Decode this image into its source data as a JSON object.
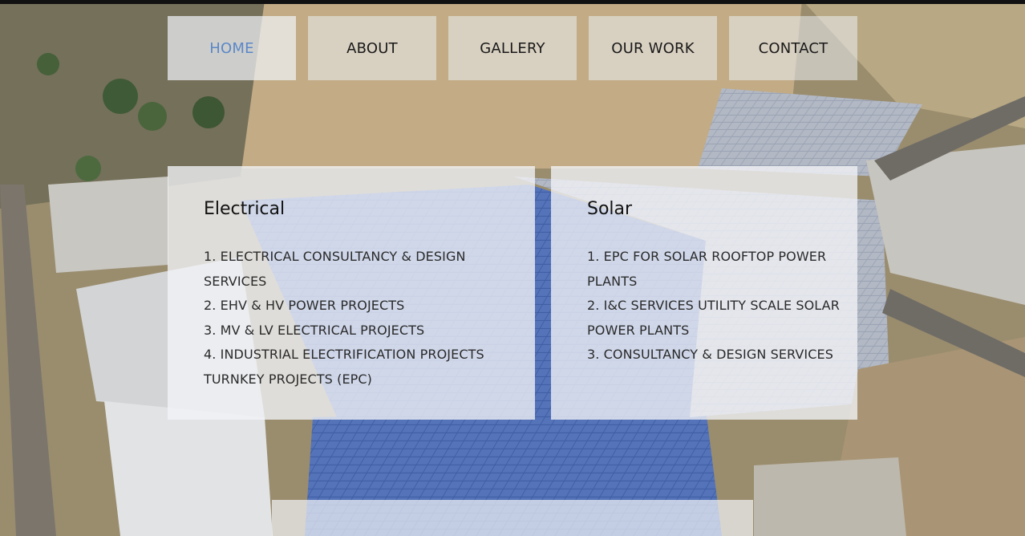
{
  "nav": {
    "items": [
      {
        "label": "HOME",
        "active": true
      },
      {
        "label": "ABOUT",
        "active": false
      },
      {
        "label": "GALLERY",
        "active": false
      },
      {
        "label": "OUR WORK",
        "active": false
      },
      {
        "label": "CONTACT",
        "active": false
      }
    ],
    "active_color": "#5b87c9"
  },
  "services": {
    "electrical": {
      "title": "Electrical",
      "items": [
        "1. ELECTRICAL CONSULTANCY & DESIGN SERVICES",
        "2. EHV & HV POWER PROJECTS",
        "3. MV & LV ELECTRICAL PROJECTS",
        "4. INDUSTRIAL ELECTRIFICATION PROJECTS TURNKEY PROJECTS (EPC)"
      ]
    },
    "solar": {
      "title": "Solar",
      "items": [
        "1. EPC FOR SOLAR ROOFTOP POWER PLANTS",
        "2. I&C SERVICES UTILITY SCALE SOLAR POWER PLANTS",
        "3. CONSULTANCY & DESIGN SERVICES"
      ]
    }
  },
  "background": {
    "image": "aerial-solar-rooftop-photo",
    "colors": {
      "ground": "#9c8e6e",
      "roof": "#b7babf",
      "panel": "#3d5a9e"
    }
  }
}
